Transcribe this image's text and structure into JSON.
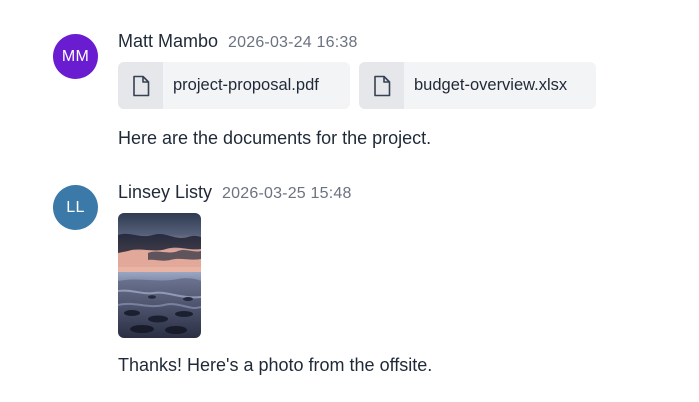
{
  "messages": [
    {
      "author": "Matt Mambo",
      "initials": "MM",
      "avatar_color": "#6a1cd1",
      "timestamp": "2026-03-24 16:38",
      "attachments": [
        {
          "name": "project-proposal.pdf",
          "icon": "file-icon"
        },
        {
          "name": "budget-overview.xlsx",
          "icon": "file-icon"
        }
      ],
      "text": "Here are the documents for the project."
    },
    {
      "author": "Linsey Listy",
      "initials": "LL",
      "avatar_color": "#3b7aa8",
      "timestamp": "2026-03-25 15:48",
      "image": {
        "subject": "sunset over rocky shoreline"
      },
      "text": "Thanks! Here's a photo from the offsite."
    }
  ]
}
